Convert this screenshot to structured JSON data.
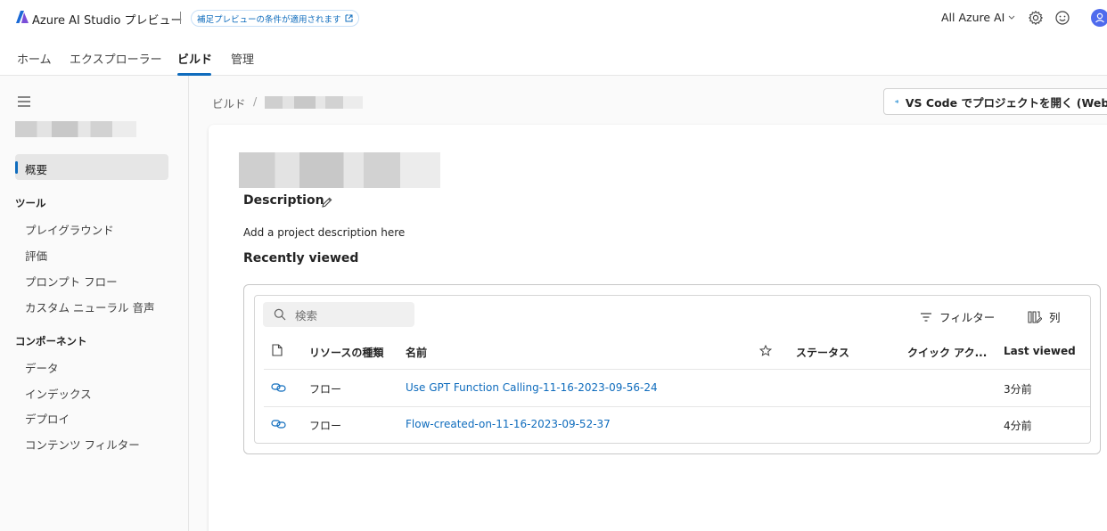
{
  "header": {
    "app_title": "Azure AI Studio プレビュー",
    "preview_notice": "補足プレビューの条件が適用されます",
    "scope": "All Azure AI",
    "icons": [
      "settings-icon",
      "feedback-smiley-icon",
      "user-avatar"
    ]
  },
  "nav": {
    "tabs": [
      "ホーム",
      "エクスプローラー",
      "ビルド",
      "管理"
    ],
    "active": "ビルド"
  },
  "sidebar": {
    "active_item": "概要",
    "sections": [
      {
        "title": "ツール",
        "items": [
          "プレイグラウンド",
          "評価",
          "プロンプト フロー",
          "カスタム ニューラル 音声"
        ]
      },
      {
        "title": "コンポーネント",
        "items": [
          "データ",
          "インデックス",
          "デプロイ",
          "コンテンツ フィルター"
        ]
      }
    ]
  },
  "breadcrumb": {
    "root": "ビルド",
    "separator": "/"
  },
  "actions": {
    "vscode_button": "VS Code でプロジェクトを開く (Web)"
  },
  "project": {
    "description_title": "Description",
    "description_text": "Add a project description here",
    "recent_title": "Recently viewed"
  },
  "table": {
    "search_placeholder": "検索",
    "filter_label": "フィルター",
    "columns_label": "列",
    "headers": {
      "resource_type": "リソースの種類",
      "name": "名前",
      "status": "ステータス",
      "quick_actions": "クイック アク...",
      "last_viewed": "Last viewed"
    },
    "rows": [
      {
        "type": "フロー",
        "name": "Use GPT Function Calling-11-16-2023-09-56-24",
        "last_viewed": "3分前"
      },
      {
        "type": "フロー",
        "name": "Flow-created-on-11-16-2023-09-52-37",
        "last_viewed": "4分前"
      }
    ]
  },
  "colors": {
    "accent": "#0f6cbd",
    "avatar": "#4f6bed",
    "vscode_blue": "#007acc"
  }
}
